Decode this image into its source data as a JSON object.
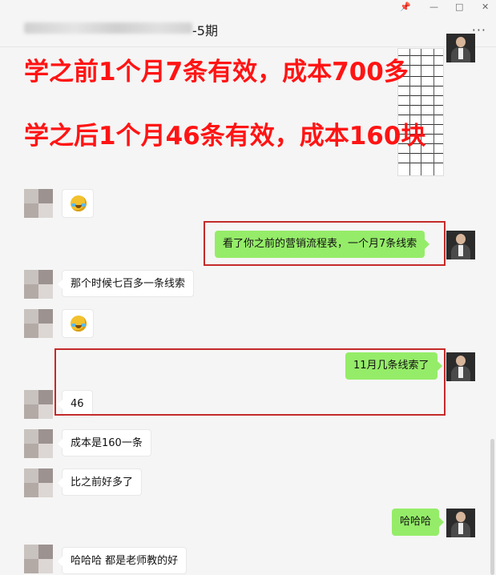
{
  "window": {
    "title": "-5期",
    "controls": [
      "📌",
      "—",
      "□",
      "✕"
    ],
    "more": "···"
  },
  "overlay": {
    "line1": "学之前1个月7条有效，成本700多",
    "line2": "学之后1个月46条有效，成本160块",
    "color": "#ff1414"
  },
  "messages": {
    "m1": "看了你之前的营销流程表，一个月7条线索",
    "m2": "那个时候七百多一条线索",
    "m3": "11月几条线索了",
    "m4": "46",
    "m5": "成本是160一条",
    "m6": "比之前好多了",
    "m7": "哈哈哈",
    "m8": "哈哈哈 都是老师教的好"
  },
  "colors": {
    "bubble_sent": "#95ec69",
    "highlight": "#c42a2a"
  }
}
